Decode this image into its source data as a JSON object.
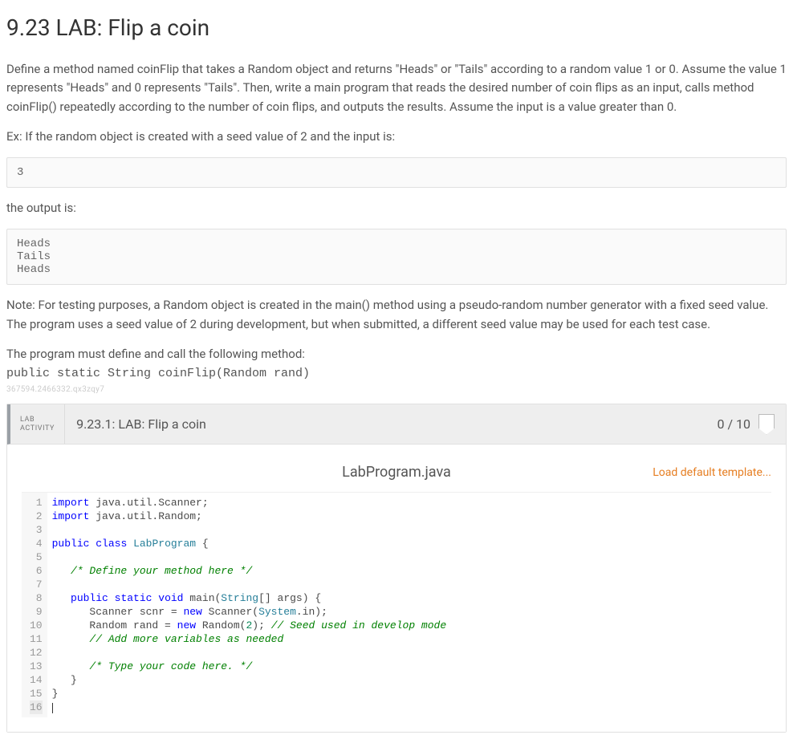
{
  "title": "9.23 LAB: Flip a coin",
  "intro": "Define a method named coinFlip that takes a Random object and returns \"Heads\" or \"Tails\" according to a random value 1 or 0. Assume the value 1 represents \"Heads\" and 0 represents \"Tails\". Then, write a main program that reads the desired number of coin flips as an input, calls method coinFlip() repeatedly according to the number of coin flips, and outputs the results. Assume the input is a value greater than 0.",
  "example_lead": "Ex: If the random object is created with a seed value of 2 and the input is:",
  "example_input": "3",
  "output_lead": "the output is:",
  "example_output": "Heads\nTails\nHeads",
  "note": "Note: For testing purposes, a Random object is created in the main() method using a pseudo-random number generator with a fixed seed value. The program uses a seed value of 2 during development, but when submitted, a different seed value may be used for each test case.",
  "method_lead": "The program must define and call the following method:",
  "method_sig": "public static String coinFlip(Random rand)",
  "meta_id": "367594.2466332.qx3zqy7",
  "lab": {
    "badge1": "LAB",
    "badge2": "ACTIVITY",
    "title": "9.23.1: LAB: Flip a coin",
    "score": "0 / 10"
  },
  "file": {
    "name": "LabProgram.java",
    "load_template": "Load default template..."
  },
  "code": {
    "lines": [
      {
        "n": "1",
        "segs": [
          {
            "t": "import",
            "c": "kw"
          },
          {
            "t": " java.util.Scanner;",
            "c": ""
          }
        ]
      },
      {
        "n": "2",
        "segs": [
          {
            "t": "import",
            "c": "kw"
          },
          {
            "t": " java.util.Random;",
            "c": ""
          }
        ]
      },
      {
        "n": "3",
        "segs": []
      },
      {
        "n": "4",
        "segs": [
          {
            "t": "public",
            "c": "kw"
          },
          {
            "t": " ",
            "c": ""
          },
          {
            "t": "class",
            "c": "kw"
          },
          {
            "t": " ",
            "c": ""
          },
          {
            "t": "LabProgram",
            "c": "cls"
          },
          {
            "t": " {",
            "c": ""
          }
        ]
      },
      {
        "n": "5",
        "segs": []
      },
      {
        "n": "6",
        "segs": [
          {
            "t": "   ",
            "c": ""
          },
          {
            "t": "/* Define your method here */",
            "c": "str-comment"
          }
        ]
      },
      {
        "n": "7",
        "segs": []
      },
      {
        "n": "8",
        "segs": [
          {
            "t": "   ",
            "c": ""
          },
          {
            "t": "public",
            "c": "kw"
          },
          {
            "t": " ",
            "c": ""
          },
          {
            "t": "static",
            "c": "kw"
          },
          {
            "t": " ",
            "c": ""
          },
          {
            "t": "void",
            "c": "kw"
          },
          {
            "t": " main(",
            "c": ""
          },
          {
            "t": "String",
            "c": "cls"
          },
          {
            "t": "[] args) {",
            "c": ""
          }
        ]
      },
      {
        "n": "9",
        "segs": [
          {
            "t": "      Scanner scnr = ",
            "c": ""
          },
          {
            "t": "new",
            "c": "kw"
          },
          {
            "t": " Scanner(",
            "c": ""
          },
          {
            "t": "System",
            "c": "cls"
          },
          {
            "t": ".in);",
            "c": ""
          }
        ]
      },
      {
        "n": "10",
        "segs": [
          {
            "t": "      Random rand = ",
            "c": ""
          },
          {
            "t": "new",
            "c": "kw"
          },
          {
            "t": " Random(",
            "c": ""
          },
          {
            "t": "2",
            "c": "num"
          },
          {
            "t": "); ",
            "c": ""
          },
          {
            "t": "// Seed used in develop mode",
            "c": "str-comment"
          }
        ]
      },
      {
        "n": "11",
        "segs": [
          {
            "t": "      ",
            "c": ""
          },
          {
            "t": "// Add more variables as needed",
            "c": "str-comment"
          }
        ]
      },
      {
        "n": "12",
        "segs": []
      },
      {
        "n": "13",
        "segs": [
          {
            "t": "      ",
            "c": ""
          },
          {
            "t": "/* Type your code here. */",
            "c": "str-comment"
          }
        ]
      },
      {
        "n": "14",
        "segs": [
          {
            "t": "   }",
            "c": ""
          }
        ]
      },
      {
        "n": "15",
        "segs": [
          {
            "t": "}",
            "c": ""
          }
        ]
      },
      {
        "n": "16",
        "segs": []
      }
    ]
  }
}
